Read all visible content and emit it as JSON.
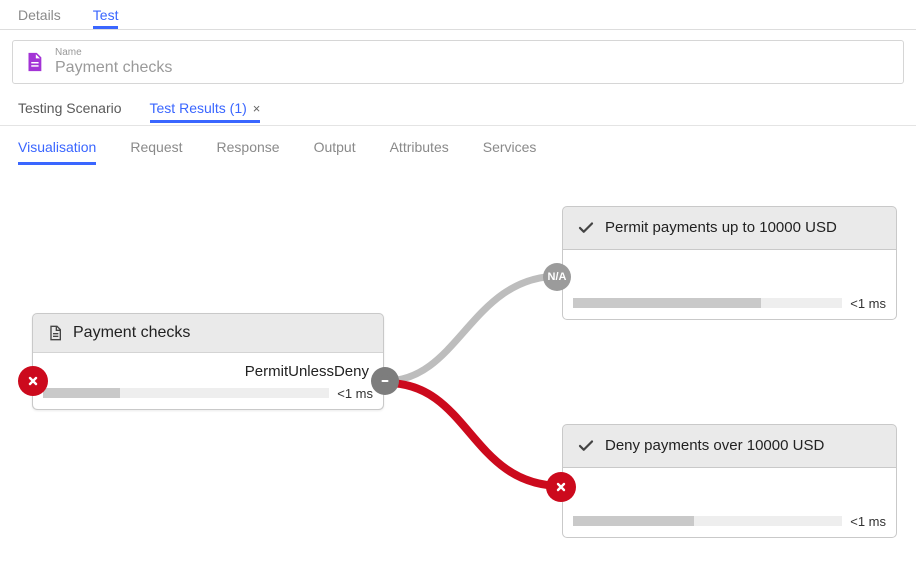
{
  "top_tabs": {
    "details": "Details",
    "test": "Test"
  },
  "name_field": {
    "label": "Name",
    "value": "Payment checks"
  },
  "subtabs1": {
    "scenario": "Testing Scenario",
    "results": "Test Results (1)"
  },
  "subtabs2": {
    "visualisation": "Visualisation",
    "request": "Request",
    "response": "Response",
    "output": "Output",
    "attributes": "Attributes",
    "services": "Services"
  },
  "policy": {
    "title": "Payment checks",
    "algorithm": "PermitUnlessDeny",
    "timing": "<1 ms"
  },
  "rule1": {
    "title": "Permit payments up to 10000 USD",
    "timing": "<1 ms"
  },
  "rule2": {
    "title": "Deny payments over 10000 USD",
    "timing": "<1 ms"
  },
  "na_label": "N/A"
}
